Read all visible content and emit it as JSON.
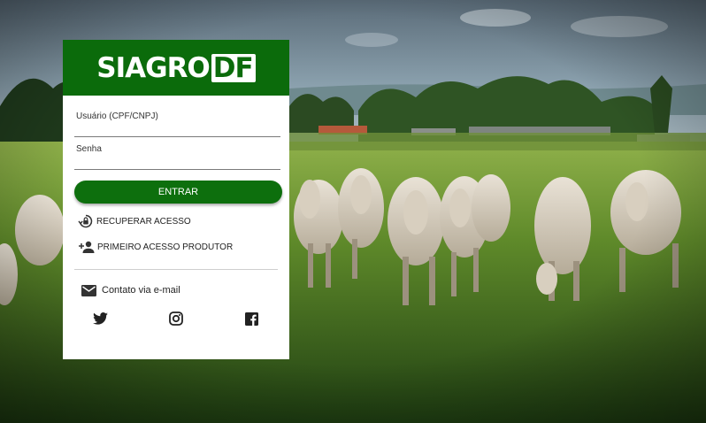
{
  "brand": {
    "logo_main": "SIAGRO",
    "logo_suffix": "DF",
    "green": "#0a6e0a",
    "green_header": "#0b6b0b",
    "button_green": "#0d6f0d"
  },
  "login": {
    "user_label": "Usuário (CPF/CNPJ)",
    "user_value": "",
    "password_label": "Senha",
    "password_value": "",
    "submit_label": "ENTRAR"
  },
  "links": {
    "recover_label": "RECUPERAR ACESSO",
    "recover_icon": "lock-reset-icon",
    "first_access_label": "PRIMEIRO ACESSO PRODUTOR",
    "first_access_icon": "add-user-icon"
  },
  "contact": {
    "email_label": "Contato via e-mail",
    "email_icon": "email-icon"
  },
  "social": [
    {
      "name": "twitter",
      "icon": "twitter-icon"
    },
    {
      "name": "instagram",
      "icon": "instagram-icon"
    },
    {
      "name": "facebook",
      "icon": "facebook-icon"
    }
  ],
  "background": {
    "scene": "cattle-pasture-photo"
  }
}
